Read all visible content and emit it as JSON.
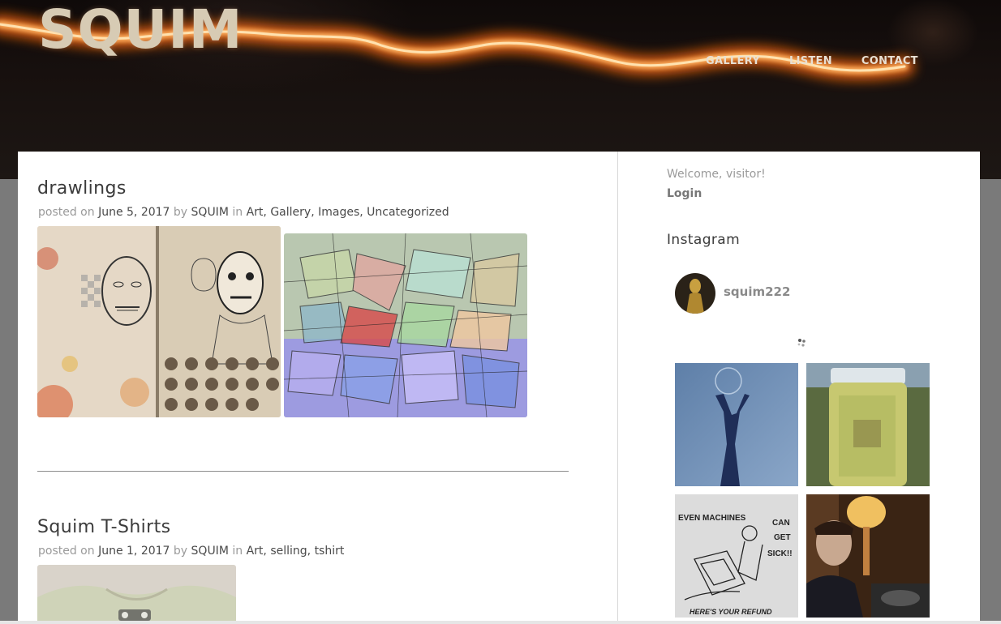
{
  "site": {
    "title": "SQUIM",
    "nav": [
      "GALLERY",
      "LISTEN",
      "CONTACT"
    ]
  },
  "posts": [
    {
      "title": "drawlings",
      "meta": {
        "posted_on": "posted on",
        "date": "June 5, 2017",
        "by": "by",
        "author": "SQUIM",
        "in": "in",
        "categories": [
          "Art",
          "Gallery",
          "Images",
          "Uncategorized"
        ]
      }
    },
    {
      "title": "Squim T-Shirts",
      "meta": {
        "posted_on": "posted on",
        "date": "June 1, 2017",
        "by": "by",
        "author": "SQUIM",
        "in": "in",
        "categories": [
          "Art",
          "selling",
          "tshirt"
        ]
      }
    }
  ],
  "sidebar": {
    "welcome": "Welcome, visitor!",
    "login": "Login",
    "instagram": {
      "heading": "Instagram",
      "username": "squim222",
      "tile_texts": {
        "machines": "EVEN MACHINES",
        "can": "CAN",
        "get": "GET",
        "sick": "SICK!!",
        "refund": "HERE'S YOUR REFUND"
      }
    }
  },
  "colors": {
    "title": "#d7cbb4",
    "nav": "#e8e0d4",
    "streak": "#ff8a2a",
    "page_bg": "#7a7a7a",
    "card_bg": "#ffffff",
    "meta_gray": "#9a9a9a",
    "link_dark": "#4a4a4a"
  },
  "icons": [
    "instagram-spinner-icon"
  ]
}
